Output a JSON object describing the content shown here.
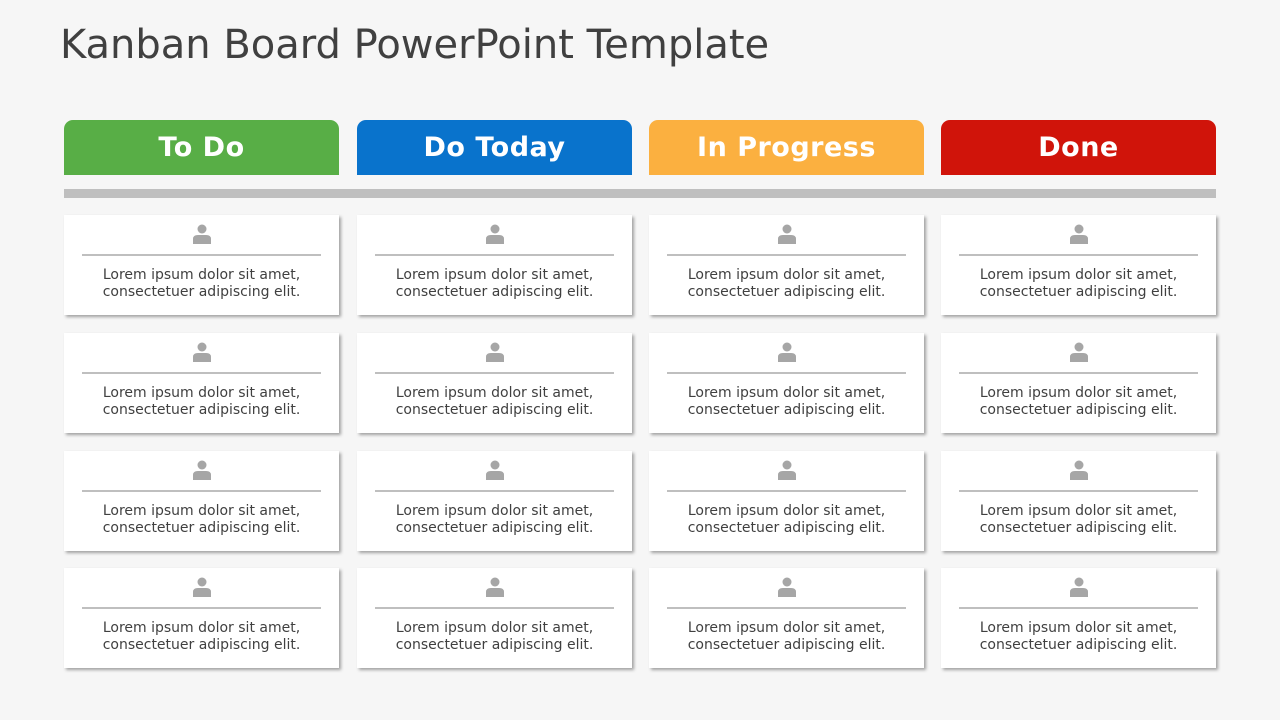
{
  "title": "Kanban Board PowerPoint Template",
  "columns": [
    {
      "label": "To Do",
      "color": "#58ae46",
      "cards": [
        {
          "line1": "Lorem ipsum dolor sit amet,",
          "line2": "consectetuer adipiscing elit."
        },
        {
          "line1": "Lorem ipsum dolor sit amet,",
          "line2": "consectetuer adipiscing elit."
        },
        {
          "line1": "Lorem ipsum dolor sit amet,",
          "line2": "consectetuer adipiscing elit."
        },
        {
          "line1": "Lorem ipsum dolor sit amet,",
          "line2": "consectetuer adipiscing elit."
        }
      ]
    },
    {
      "label": "Do Today",
      "color": "#0973cc",
      "cards": [
        {
          "line1": "Lorem ipsum dolor sit amet,",
          "line2": "consectetuer adipiscing elit."
        },
        {
          "line1": "Lorem ipsum dolor sit amet,",
          "line2": "consectetuer adipiscing elit."
        },
        {
          "line1": "Lorem ipsum dolor sit amet,",
          "line2": "consectetuer adipiscing elit."
        },
        {
          "line1": "Lorem ipsum dolor sit amet,",
          "line2": "consectetuer adipiscing elit."
        }
      ]
    },
    {
      "label": "In Progress",
      "color": "#fbb040",
      "cards": [
        {
          "line1": "Lorem ipsum dolor sit amet,",
          "line2": "consectetuer adipiscing elit."
        },
        {
          "line1": "Lorem ipsum dolor sit amet,",
          "line2": "consectetuer adipiscing elit."
        },
        {
          "line1": "Lorem ipsum dolor sit amet,",
          "line2": "consectetuer adipiscing elit."
        },
        {
          "line1": "Lorem ipsum dolor sit amet,",
          "line2": "consectetuer adipiscing elit."
        }
      ]
    },
    {
      "label": "Done",
      "color": "#d0140a",
      "cards": [
        {
          "line1": "Lorem ipsum dolor sit amet,",
          "line2": "consectetuer adipiscing elit."
        },
        {
          "line1": "Lorem ipsum dolor sit amet,",
          "line2": "consectetuer adipiscing elit."
        },
        {
          "line1": "Lorem ipsum dolor sit amet,",
          "line2": "consectetuer adipiscing elit."
        },
        {
          "line1": "Lorem ipsum dolor sit amet,",
          "line2": "consectetuer adipiscing elit."
        }
      ]
    }
  ],
  "card_icon": "person-icon"
}
